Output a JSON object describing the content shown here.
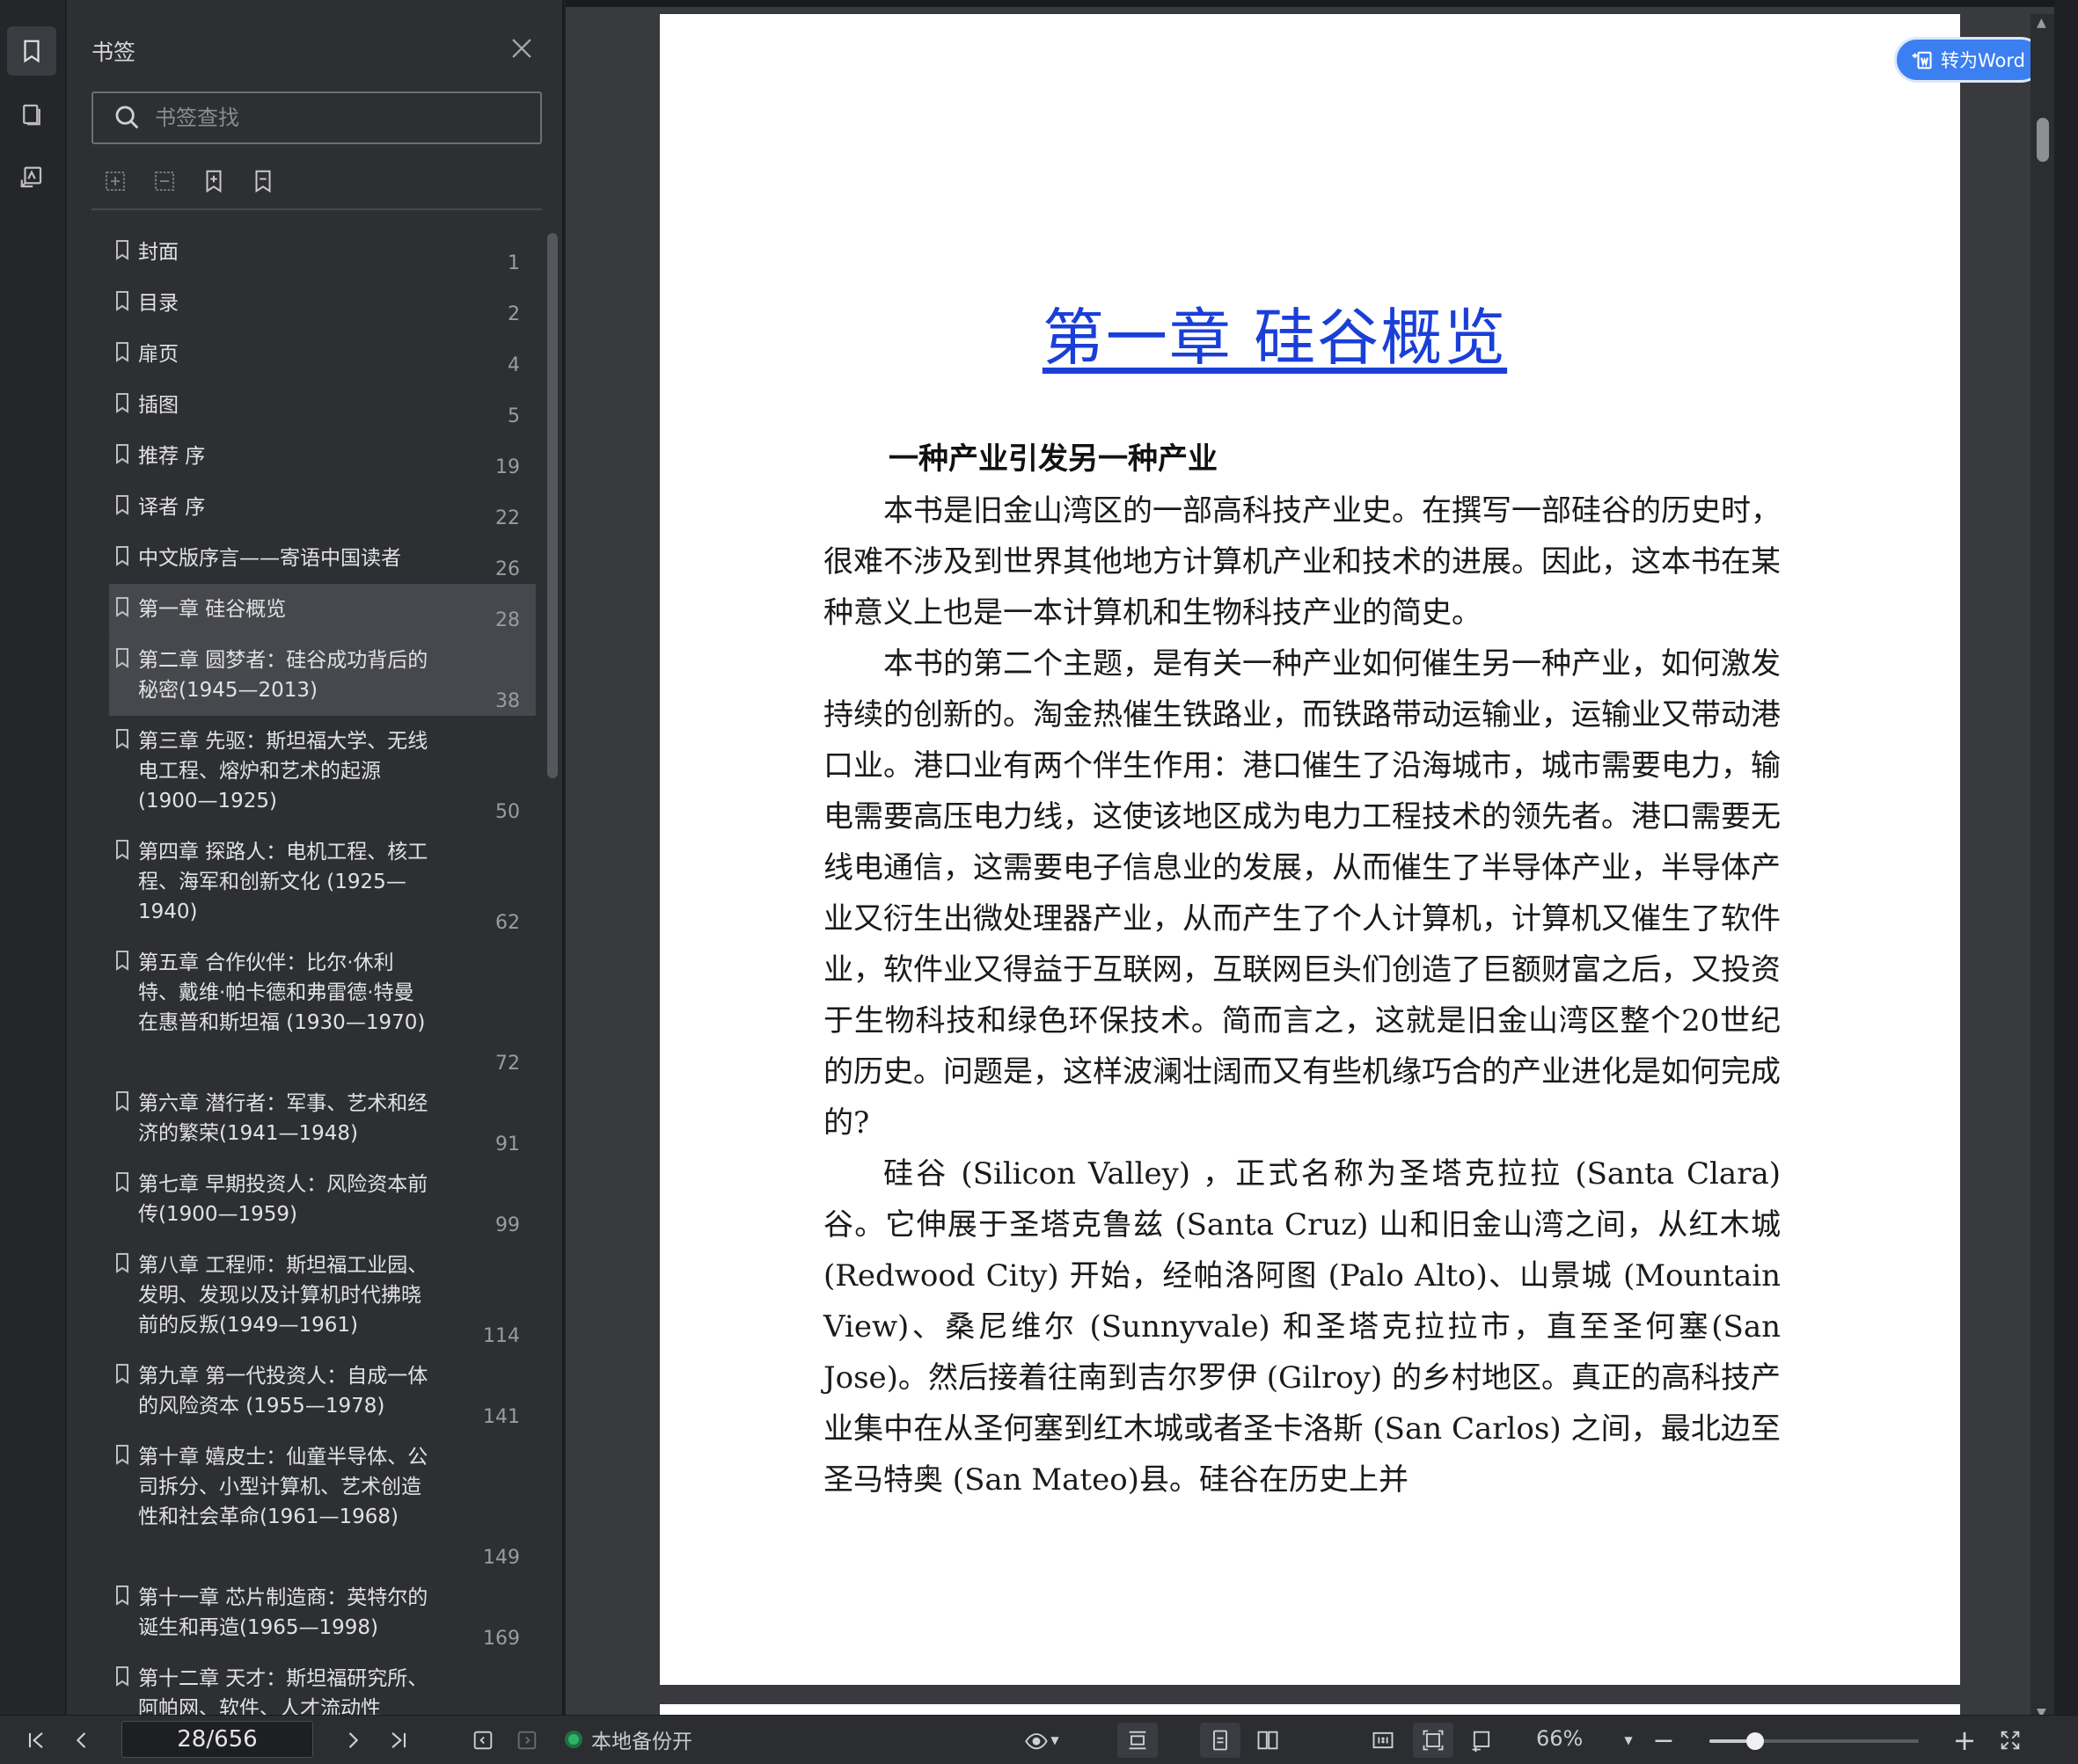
{
  "sidebar": {
    "title": "书签",
    "search_placeholder": "书签查找",
    "bookmarks": [
      {
        "label": "封面",
        "page": "1"
      },
      {
        "label": "目录",
        "page": "2"
      },
      {
        "label": "扉页",
        "page": "4"
      },
      {
        "label": "插图",
        "page": "5"
      },
      {
        "label": "推荐 序",
        "page": "19"
      },
      {
        "label": "译者 序",
        "page": "22"
      },
      {
        "label": "中文版序言——寄语中国读者",
        "page": "26"
      },
      {
        "label": "第一章 硅谷概览",
        "page": "28"
      },
      {
        "label": "第二章 圆梦者：硅谷成功背后的秘密(1945—2013)",
        "page": "38"
      },
      {
        "label": "第三章 先驱：斯坦福大学、无线电工程、熔炉和艺术的起源 (1900—1925)",
        "page": "50"
      },
      {
        "label": "第四章 探路人：电机工程、核工程、海军和创新文化 (1925—1940)",
        "page": "62"
      },
      {
        "label": "第五章 合作伙伴：比尔·休利特、戴维·帕卡德和弗雷德·特曼在惠普和斯坦福 (1930—1970)",
        "page": "72"
      },
      {
        "label": "第六章 潜行者：军事、艺术和经济的繁荣(1941—1948)",
        "page": "91"
      },
      {
        "label": "第七章 早期投资人：风险资本前传(1900—1959)",
        "page": "99"
      },
      {
        "label": "第八章 工程师：斯坦福工业园、发明、发现以及计算机时代拂晓前的反叛(1949—1961)",
        "page": "114"
      },
      {
        "label": "第九章 第一代投资人：自成一体的风险资本 (1955—1978)",
        "page": "141"
      },
      {
        "label": "第十章 嬉皮士：仙童半导体、公司拆分、小型计算机、艺术创造性和社会革命(1961—1968)",
        "page": "149"
      },
      {
        "label": "第十一章 芯片制造商：英特尔的诞生和再造(1965—1998)",
        "page": "169"
      },
      {
        "label": "第十二章 天才：斯坦福研究所、阿帕网、软件、人才流动性",
        "page": ""
      }
    ],
    "selected_index": 7
  },
  "document": {
    "chapter_title": "第一章  硅谷概览",
    "section_heading": "一种产业引发另一种产业",
    "paragraphs": [
      "本书是旧金山湾区的一部高科技产业史。在撰写一部硅谷的历史时，很难不涉及到世界其他地方计算机产业和技术的进展。因此，这本书在某种意义上也是一本计算机和生物科技产业的简史。",
      "本书的第二个主题，是有关一种产业如何催生另一种产业，如何激发持续的创新的。淘金热催生铁路业，而铁路带动运输业，运输业又带动港口业。港口业有两个伴生作用：港口催生了沿海城市，城市需要电力，输电需要高压电力线，这使该地区成为电力工程技术的领先者。港口需要无线电通信，这需要电子信息业的发展，从而催生了半导体产业，半导体产业又衍生出微处理器产业，从而产生了个人计算机，计算机又催生了软件业，软件业又得益于互联网，互联网巨头们创造了巨额财富之后，又投资于生物科技和绿色环保技术。简而言之，这就是旧金山湾区整个20世纪的历史。问题是，这样波澜壮阔而又有些机缘巧合的产业进化是如何完成的?",
      "硅谷 (Silicon Valley) ，正式名称为圣塔克拉拉 (Santa Clara) 谷。它伸展于圣塔克鲁兹 (Santa Cruz) 山和旧金山湾之间，从红木城 (Redwood City) 开始，经帕洛阿图 (Palo Alto)、山景城 (Mountain View)、桑尼维尔 (Sunnyvale) 和圣塔克拉拉市，直至圣何塞(San Jose)。然后接着往南到吉尔罗伊 (Gilroy) 的乡村地区。真正的高科技产业集中在从圣何塞到红木城或者圣卡洛斯 (San Carlos) 之间，最北边至圣马特奥 (San Mateo)县。硅谷在历史上并"
    ],
    "convert_button": "转为Word"
  },
  "statusbar": {
    "page_indicator": "28/656",
    "backup_label": "本地备份开",
    "zoom": "66%",
    "zoom_fraction": 0.22
  },
  "colors": {
    "accent": "#3b7ff0",
    "chapter_title": "#1a3fd8",
    "backup_dot": "#2fb36b"
  }
}
